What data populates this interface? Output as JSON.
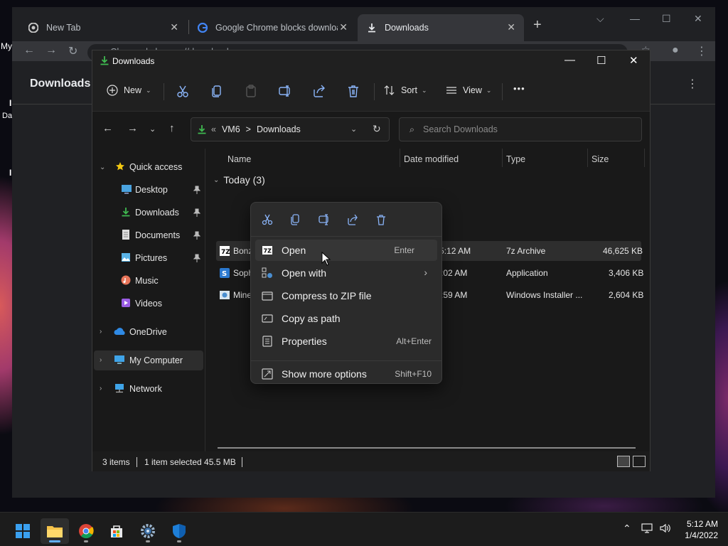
{
  "desktop": {
    "edge_labels": [
      "My",
      "I",
      "Da",
      "I"
    ]
  },
  "chrome": {
    "tabs": [
      {
        "label": "New Tab",
        "icon": "chrome-icon"
      },
      {
        "label": "Google Chrome blocks downloa",
        "icon": "google-icon"
      },
      {
        "label": "Downloads",
        "icon": "download-icon"
      }
    ],
    "omnibox_text": "Chrome  |  chrome://downloads",
    "page_title": "Downloads"
  },
  "explorer": {
    "title": "Downloads",
    "command_bar": {
      "new_label": "New",
      "sort_label": "Sort",
      "view_label": "View",
      "more_label": "•••"
    },
    "address": {
      "prefix": "«",
      "crumb1": "VM6",
      "separator": ">",
      "crumb2": "Downloads"
    },
    "search_placeholder": "Search Downloads",
    "nav_pane": {
      "quick_access": "Quick access",
      "items": [
        {
          "label": "Desktop",
          "icon": "desktop-icon",
          "pinned": true
        },
        {
          "label": "Downloads",
          "icon": "downloads-icon",
          "pinned": true
        },
        {
          "label": "Documents",
          "icon": "documents-icon",
          "pinned": true
        },
        {
          "label": "Pictures",
          "icon": "pictures-icon",
          "pinned": true
        },
        {
          "label": "Music",
          "icon": "music-icon",
          "pinned": false
        },
        {
          "label": "Videos",
          "icon": "videos-icon",
          "pinned": false
        }
      ],
      "onedrive": "OneDrive",
      "my_computer": "My Computer",
      "network": "Network"
    },
    "columns": {
      "name": "Name",
      "date_modified": "Date modified",
      "type": "Type",
      "size": "Size"
    },
    "group_header": "Today (3)",
    "files": [
      {
        "name": "BonziBuddy432.7z",
        "date": "1/4/2022 5:12 AM",
        "type": "7z Archive",
        "size": "46,625 KB",
        "icon": "7z-icon"
      },
      {
        "name": "Soph",
        "date": ":02 AM",
        "type": "Application",
        "size": "3,406 KB",
        "icon": "app-icon"
      },
      {
        "name": "Mine",
        "date": ":59 AM",
        "type": "Windows Installer ...",
        "size": "2,604 KB",
        "icon": "installer-icon"
      }
    ],
    "status": {
      "items": "3 items",
      "selected": "1 item selected  45.5 MB"
    }
  },
  "context_menu": {
    "items": [
      {
        "label": "Open",
        "shortcut": "Enter",
        "icon": "7z-icon"
      },
      {
        "label": "Open with",
        "shortcut": "",
        "icon": "open-with-icon",
        "submenu": true
      },
      {
        "label": "Compress to ZIP file",
        "shortcut": "",
        "icon": "zip-icon"
      },
      {
        "label": "Copy as path",
        "shortcut": "",
        "icon": "copy-path-icon"
      },
      {
        "label": "Properties",
        "shortcut": "Alt+Enter",
        "icon": "properties-icon"
      },
      {
        "label": "Show more options",
        "shortcut": "Shift+F10",
        "icon": "more-options-icon"
      }
    ]
  },
  "taskbar": {
    "apps": [
      "start-icon",
      "file-explorer-icon",
      "chrome-icon",
      "store-icon",
      "settings-icon",
      "defender-icon"
    ],
    "time": "5:12 AM",
    "date": "1/4/2022"
  }
}
